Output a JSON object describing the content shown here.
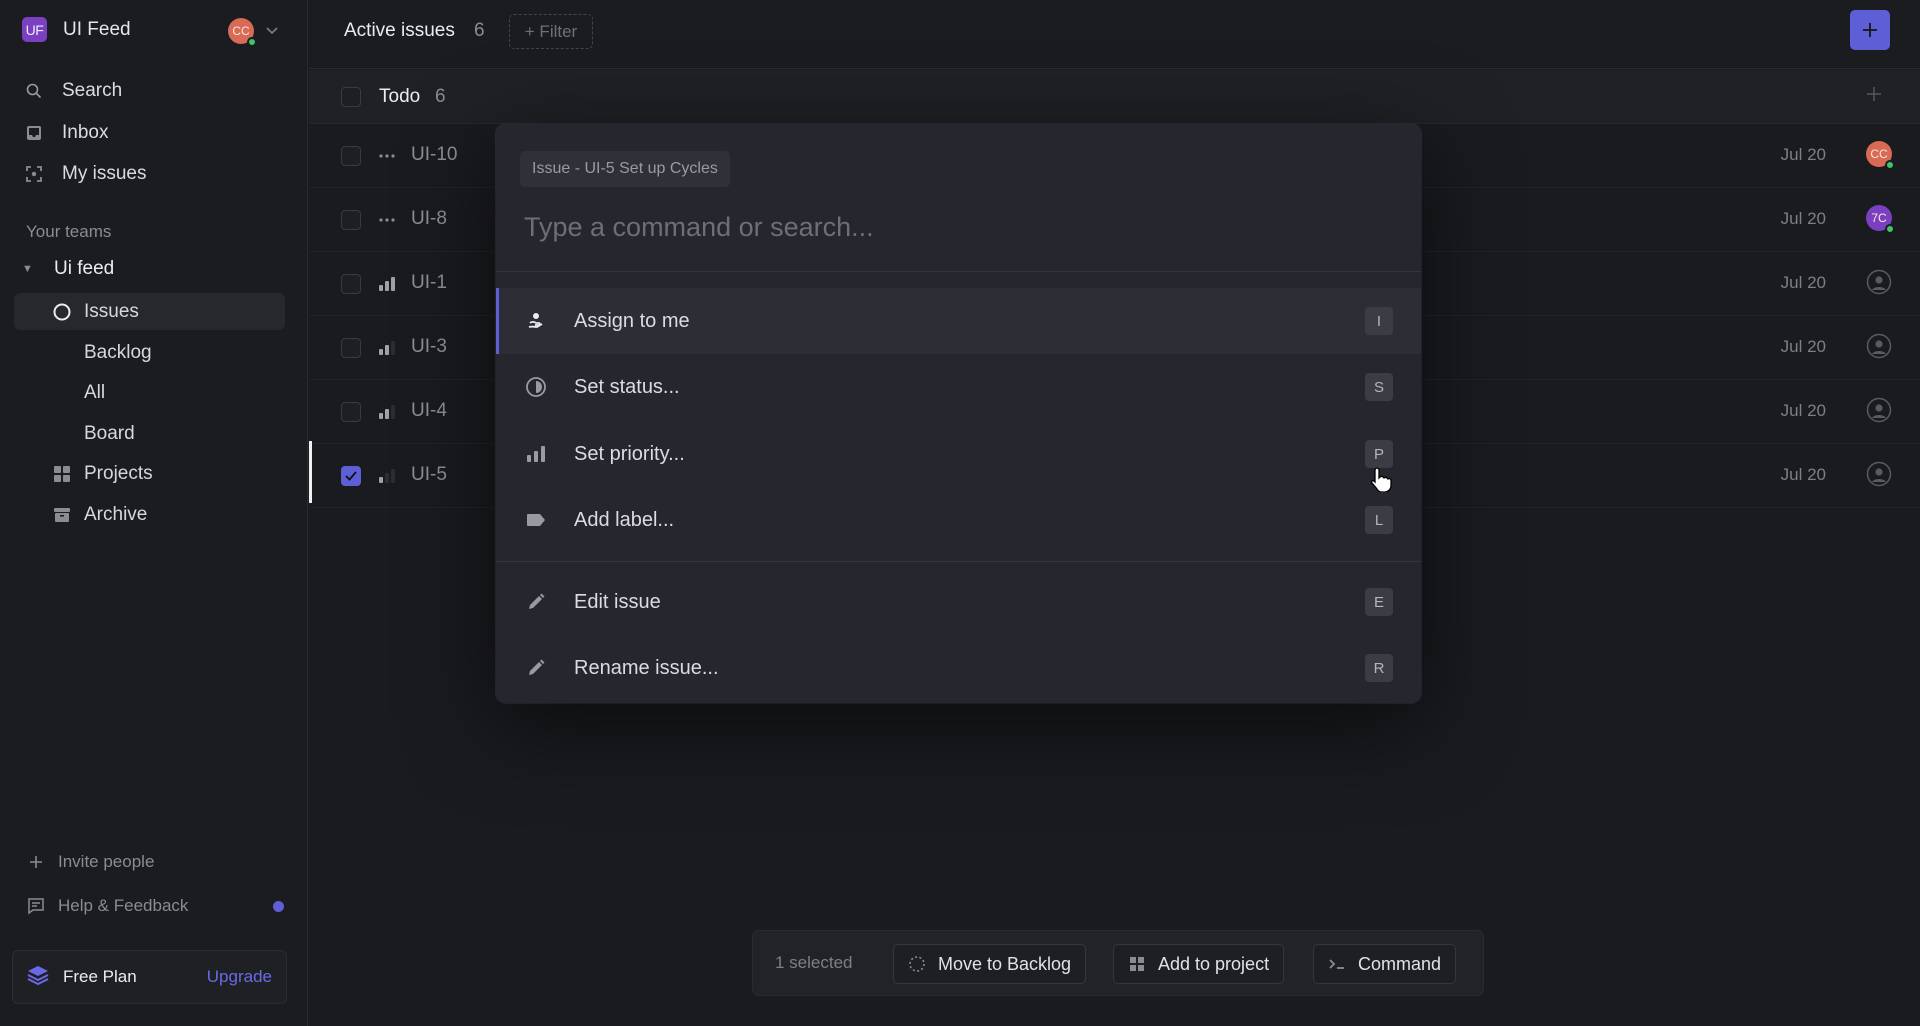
{
  "workspace": {
    "initials": "UF",
    "name": "UI Feed",
    "user_initials": "CC",
    "accent": "#5e5ed6"
  },
  "sidebar": {
    "nav": [
      {
        "label": "Search",
        "icon": "search-icon"
      },
      {
        "label": "Inbox",
        "icon": "inbox-icon"
      },
      {
        "label": "My issues",
        "icon": "my-issues-icon"
      }
    ],
    "teams_label": "Your teams",
    "team": {
      "name": "Ui feed",
      "items": [
        {
          "label": "Issues",
          "icon": "circle-icon",
          "active": true
        },
        {
          "label": "Backlog"
        },
        {
          "label": "All"
        },
        {
          "label": "Board"
        },
        {
          "label": "Projects",
          "icon": "grid-icon"
        },
        {
          "label": "Archive",
          "icon": "archive-icon"
        }
      ]
    },
    "invite_label": "Invite people",
    "help_label": "Help & Feedback",
    "plan": {
      "name": "Free Plan",
      "upgrade_label": "Upgrade"
    }
  },
  "header": {
    "title": "Active issues",
    "count": "6",
    "filter_label": "+ Filter"
  },
  "group": {
    "name": "Todo",
    "count": "6"
  },
  "issues": [
    {
      "id": "UI-10",
      "priority": "none",
      "date": "Jul 20",
      "assignee": {
        "initials": "CC",
        "color": "#d86a56",
        "online": true
      },
      "selected": false
    },
    {
      "id": "UI-8",
      "priority": "none",
      "date": "Jul 20",
      "assignee": {
        "initials": "7C",
        "color": "#7a40c0",
        "online": true
      },
      "selected": false
    },
    {
      "id": "UI-1",
      "priority": "high",
      "date": "Jul 20",
      "assignee": null,
      "selected": false
    },
    {
      "id": "UI-3",
      "priority": "medium",
      "date": "Jul 20",
      "assignee": null,
      "selected": false
    },
    {
      "id": "UI-4",
      "priority": "medium",
      "date": "Jul 20",
      "assignee": null,
      "selected": false
    },
    {
      "id": "UI-5",
      "priority": "low",
      "date": "Jul 20",
      "assignee": null,
      "selected": true
    }
  ],
  "command_palette": {
    "context": "Issue - UI-5 Set up Cycles",
    "placeholder": "Type a command or search...",
    "value": "",
    "items": [
      {
        "label": "Assign to me",
        "shortcut": "I",
        "icon": "assign-icon",
        "highlighted": true
      },
      {
        "label": "Set status...",
        "shortcut": "S",
        "icon": "status-icon"
      },
      {
        "label": "Set priority...",
        "shortcut": "P",
        "icon": "priority-icon"
      },
      {
        "label": "Add label...",
        "shortcut": "L",
        "icon": "label-icon"
      },
      {
        "label": "Edit issue",
        "shortcut": "E",
        "icon": "pencil-icon"
      },
      {
        "label": "Rename issue...",
        "shortcut": "R",
        "icon": "pencil-icon"
      }
    ]
  },
  "bulk_actions": {
    "selected_label": "1 selected",
    "move_label": "Move to Backlog",
    "project_label": "Add to project",
    "command_label": "Command"
  }
}
